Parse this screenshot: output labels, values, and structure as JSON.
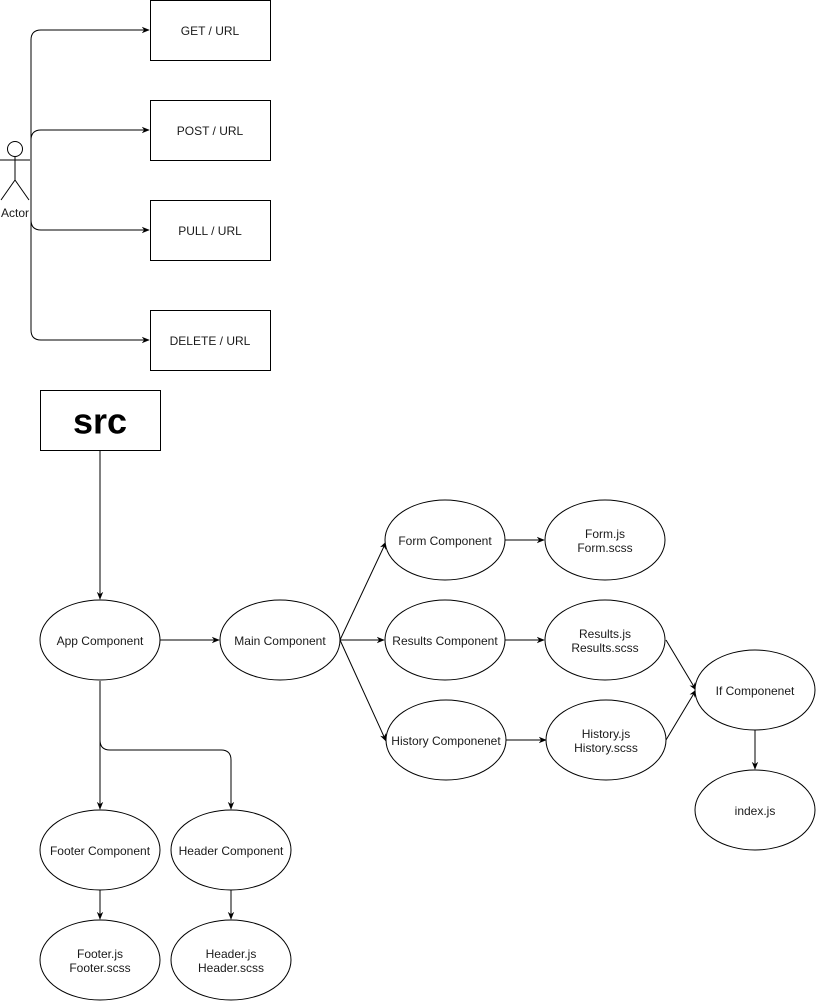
{
  "diagram": {
    "actor": {
      "label": "Actor"
    },
    "endpoints": [
      {
        "id": "get",
        "label": "GET / URL"
      },
      {
        "id": "post",
        "label": "POST / URL"
      },
      {
        "id": "pull",
        "label": "PULL / URL"
      },
      {
        "id": "delete",
        "label": "DELETE / URL"
      }
    ],
    "root": {
      "label": "src"
    },
    "nodes": {
      "app": {
        "lines": [
          "App Component"
        ]
      },
      "main": {
        "lines": [
          "Main Component"
        ]
      },
      "form": {
        "lines": [
          "Form Component"
        ]
      },
      "results": {
        "lines": [
          "Results Component"
        ]
      },
      "history": {
        "lines": [
          "History Componenet"
        ]
      },
      "form_files": {
        "lines": [
          "Form.js",
          "Form.scss"
        ]
      },
      "results_files": {
        "lines": [
          "Results.js",
          "Results.scss"
        ]
      },
      "history_files": {
        "lines": [
          "History.js",
          "History.scss"
        ]
      },
      "if": {
        "lines": [
          "If Componenet"
        ]
      },
      "index": {
        "lines": [
          "index.js"
        ]
      },
      "footer": {
        "lines": [
          "Footer Component"
        ]
      },
      "header": {
        "lines": [
          "Header Component"
        ]
      },
      "footer_files": {
        "lines": [
          "Footer.js",
          "Footer.scss"
        ]
      },
      "header_files": {
        "lines": [
          "Header.js",
          "Header.scss"
        ]
      }
    },
    "edges": [
      [
        "actor",
        "get"
      ],
      [
        "actor",
        "post"
      ],
      [
        "actor",
        "pull"
      ],
      [
        "actor",
        "delete"
      ],
      [
        "src",
        "app"
      ],
      [
        "app",
        "main"
      ],
      [
        "app",
        "footer"
      ],
      [
        "app",
        "header"
      ],
      [
        "main",
        "form"
      ],
      [
        "main",
        "results"
      ],
      [
        "main",
        "history"
      ],
      [
        "form",
        "form_files"
      ],
      [
        "results",
        "results_files"
      ],
      [
        "history",
        "history_files"
      ],
      [
        "results_files",
        "if"
      ],
      [
        "history_files",
        "if"
      ],
      [
        "if",
        "index"
      ],
      [
        "footer",
        "footer_files"
      ],
      [
        "header",
        "header_files"
      ]
    ]
  }
}
